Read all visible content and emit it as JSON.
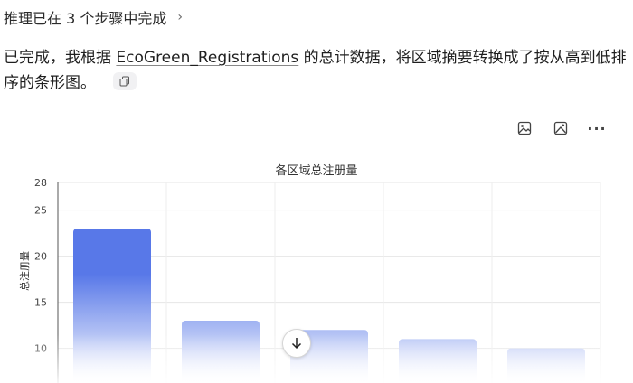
{
  "reasoning": {
    "label": "推理已在 3 个步骤中完成",
    "chevron": "›"
  },
  "answer": {
    "part1": "已完成，我根据",
    "reference": "EcoGreen_Registrations",
    "part2": "的总计数据，将区域摘要转换成了按从高到低排序的条形图。",
    "copy_icon": "copy-icon"
  },
  "toolbar": {
    "icons": [
      "image-icon",
      "image-alt-icon",
      "more-icon"
    ],
    "more_label": "···"
  },
  "chart_data": {
    "type": "bar",
    "title": "各区域总注册量",
    "ylabel": "总注册量",
    "ylim": [
      8,
      28
    ],
    "yticks": [
      10,
      15,
      20,
      25,
      28
    ],
    "grid": true,
    "colors": {
      "top": "#5878e8",
      "bottom": "#ffffff"
    },
    "values": [
      23,
      13,
      12,
      11,
      10
    ]
  },
  "scroll_button": {
    "icon": "arrow-down-icon"
  }
}
